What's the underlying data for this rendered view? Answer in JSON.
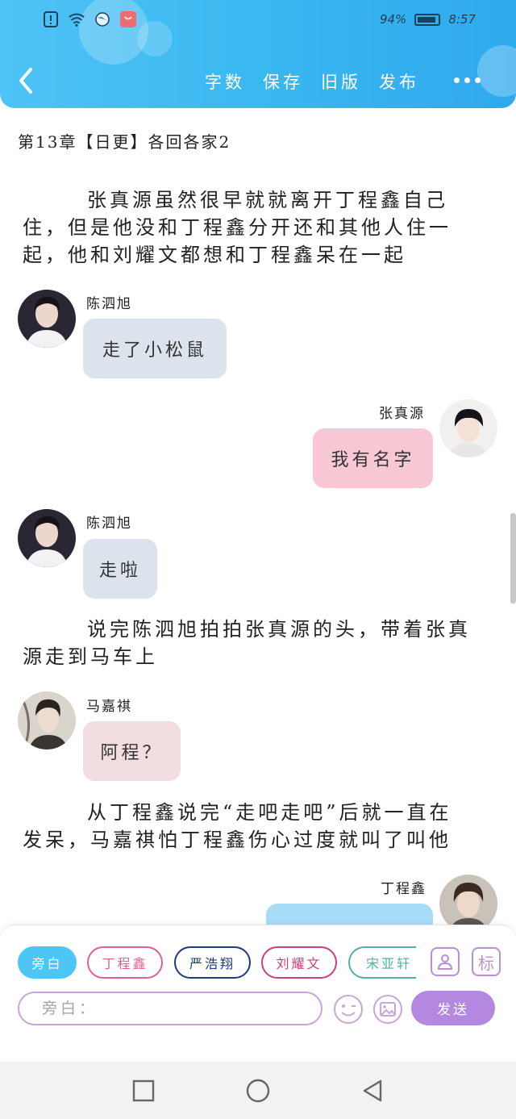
{
  "status_bar": {
    "battery_pct": "94%",
    "time": "8:57"
  },
  "toolbar": {
    "items": [
      "字数",
      "保存",
      "旧版",
      "发布"
    ]
  },
  "chapter": {
    "title": "第13章【日更】各回各家2"
  },
  "story": {
    "narration_1": "张真源虽然很早就就离开丁程鑫自己住，但是他没和丁程鑫分开还和其他人住一起，他和刘耀文都想和丁程鑫呆在一起",
    "msg_1": {
      "speaker": "陈泗旭",
      "text": "走了小松鼠"
    },
    "msg_2": {
      "speaker": "张真源",
      "text": "我有名字"
    },
    "msg_3": {
      "speaker": "陈泗旭",
      "text": "走啦"
    },
    "narration_2": "说完陈泗旭拍拍张真源的头，带着张真源走到马车上",
    "msg_4": {
      "speaker": "马嘉祺",
      "text": "阿程？"
    },
    "narration_3": "从丁程鑫说完“走吧走吧”后就一直在发呆，马嘉祺怕丁程鑫伤心过度就叫了叫他",
    "msg_5": {
      "speaker": "丁程鑫",
      "text": ""
    }
  },
  "roles": [
    {
      "label": "旁白",
      "color": "#4cc6f4"
    },
    {
      "label": "丁程鑫",
      "color": "#e0608f"
    },
    {
      "label": "严浩翔",
      "color": "#1c3b7a"
    },
    {
      "label": "刘耀文",
      "color": "#c8407e"
    },
    {
      "label": "宋亚轩",
      "color": "#4fb3a9"
    }
  ],
  "composer": {
    "placeholder": "旁白：",
    "tag_button": "标",
    "send_label": "发送"
  },
  "colors": {
    "header": "#3ab8f0",
    "bubble_gray": "#dde3ec",
    "bubble_pink": "#f8c8d4",
    "bubble_rose": "#f2dde0",
    "bubble_blue": "#a7dcf7",
    "send": "#b488e0"
  },
  "icons": [
    "back-arrow-icon",
    "more-icon",
    "avatar-icon",
    "smiley-icon",
    "image-icon",
    "square-nav-icon",
    "circle-nav-icon",
    "triangle-nav-icon"
  ]
}
